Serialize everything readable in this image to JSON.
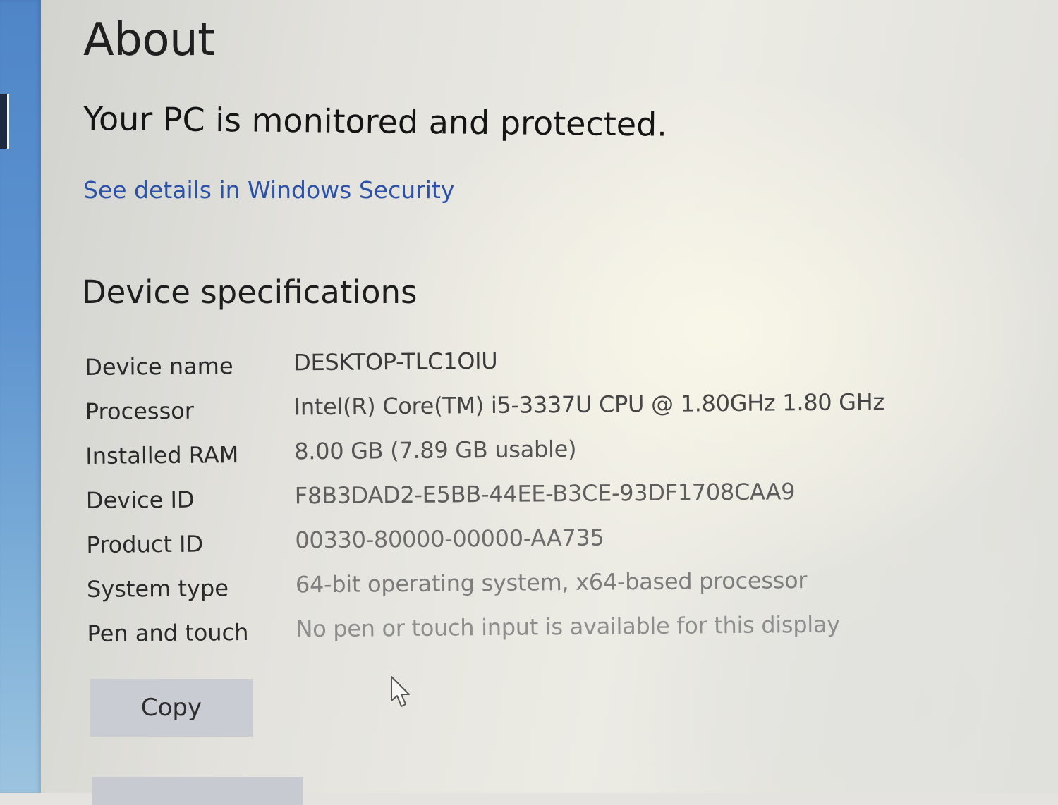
{
  "page": {
    "title": "About"
  },
  "security": {
    "status": "Your PC is monitored and protected.",
    "link_label": "See details in Windows Security"
  },
  "specs": {
    "heading": "Device specifications",
    "rows": [
      {
        "label": "Device name",
        "value": "DESKTOP-TLC1OIU"
      },
      {
        "label": "Processor",
        "value": "Intel(R) Core(TM) i5-3337U CPU @ 1.80GHz   1.80 GHz"
      },
      {
        "label": "Installed RAM",
        "value": "8.00 GB (7.89 GB usable)"
      },
      {
        "label": "Device ID",
        "value": "F8B3DAD2-E5BB-44EE-B3CE-93DF1708CAA9"
      },
      {
        "label": "Product ID",
        "value": "00330-80000-00000-AA735"
      },
      {
        "label": "System type",
        "value": "64-bit operating system, x64-based processor"
      },
      {
        "label": "Pen and touch",
        "value": "No pen or touch input is available for this display"
      }
    ],
    "copy_label": "Copy"
  },
  "colors": {
    "link": "#2b52a6",
    "sidebar_accent": "#5d93cf",
    "button_bg": "#c9ccd3"
  }
}
